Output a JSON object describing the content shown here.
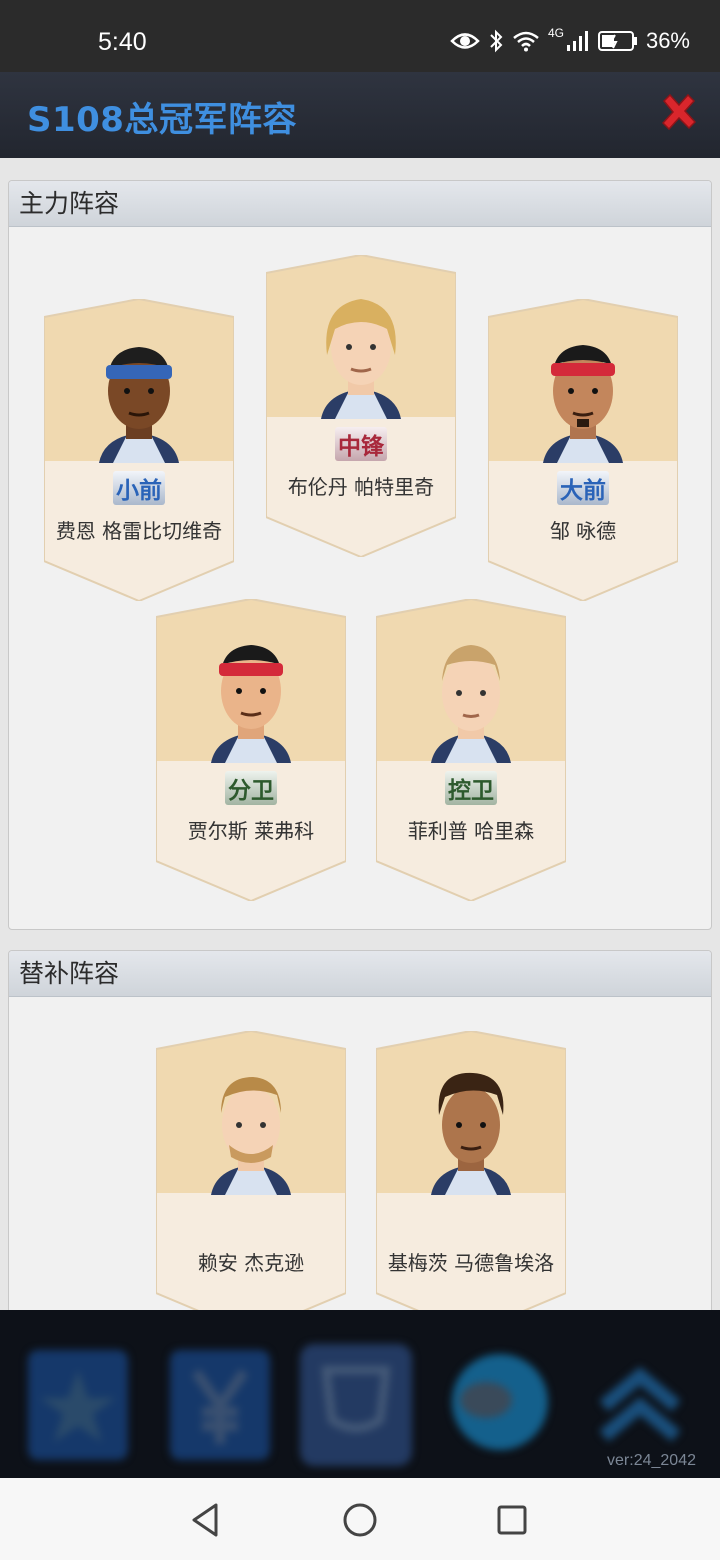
{
  "status_bar": {
    "time": "5:40",
    "network": "4G",
    "battery": "36%"
  },
  "header": {
    "title": "S108总冠军阵容"
  },
  "starters": {
    "heading": "主力阵容",
    "players": [
      {
        "position": "小前",
        "name": "费恩 格雷比切维奇"
      },
      {
        "position": "中锋",
        "name": "布伦丹 帕特里奇"
      },
      {
        "position": "大前",
        "name": "邹 咏德"
      },
      {
        "position": "分卫",
        "name": "贾尔斯 莱弗科"
      },
      {
        "position": "控卫",
        "name": "菲利普 哈里森"
      }
    ]
  },
  "bench": {
    "heading": "替补阵容",
    "players": [
      {
        "position": "",
        "name": "赖安 杰克逊"
      },
      {
        "position": "",
        "name": "基梅茨 马德鲁埃洛"
      }
    ]
  },
  "footer": {
    "version": "ver:24_2042"
  },
  "colors": {
    "title": "#3f8fe0",
    "close": "#d9262c",
    "card_top": "#f0d9b0",
    "card_bottom": "#f6ecdf"
  }
}
